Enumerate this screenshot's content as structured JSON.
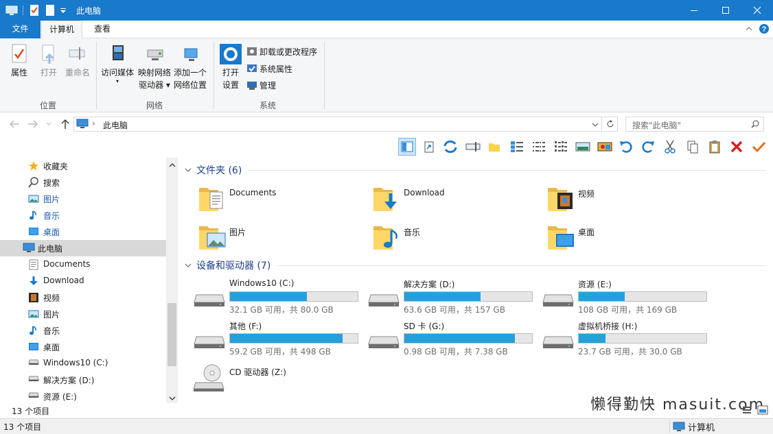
{
  "window": {
    "title": "此电脑"
  },
  "ribbon_tabs": [
    "文件",
    "计算机",
    "查看"
  ],
  "ribbon": {
    "location": {
      "properties": "属性",
      "open": "打开",
      "rename": "重命名",
      "group": "位置"
    },
    "network": {
      "access_media": "访问媒体",
      "map_drive_1": "映射网络",
      "map_drive_2": "驱动器",
      "add_location_1": "添加一个",
      "add_location_2": "网络位置",
      "group": "网络"
    },
    "system": {
      "open_settings_1": "打开",
      "open_settings_2": "设置",
      "uninstall": "卸载或更改程序",
      "sys_props": "系统属性",
      "manage": "管理",
      "group": "系统"
    }
  },
  "address": {
    "path": "此电脑",
    "search_placeholder": "搜索\"此电脑\""
  },
  "sidebar": [
    {
      "label": "收藏夹",
      "icon": "star-icon",
      "link": false
    },
    {
      "label": "搜索",
      "icon": "search-icon",
      "link": false
    },
    {
      "label": "图片",
      "icon": "pictures-icon",
      "link": true
    },
    {
      "label": "音乐",
      "icon": "music-icon",
      "link": true
    },
    {
      "label": "桌面",
      "icon": "desktop-icon",
      "link": true
    },
    {
      "label": "此电脑",
      "icon": "computer-icon",
      "link": false,
      "selected": true
    },
    {
      "label": "Documents",
      "icon": "documents-icon",
      "link": false
    },
    {
      "label": "Download",
      "icon": "download-icon",
      "link": false
    },
    {
      "label": "视频",
      "icon": "video-icon",
      "link": false
    },
    {
      "label": "图片",
      "icon": "pictures-icon",
      "link": false
    },
    {
      "label": "音乐",
      "icon": "music-icon",
      "link": false
    },
    {
      "label": "桌面",
      "icon": "desktop-icon",
      "link": false
    },
    {
      "label": "Windows10 (C:)",
      "icon": "drive-icon",
      "link": false
    },
    {
      "label": "解决方案 (D:)",
      "icon": "drive-icon",
      "link": false
    },
    {
      "label": "资源 (E:)",
      "icon": "drive-icon",
      "link": false
    }
  ],
  "folders_section": "文件夹 (6)",
  "folders": [
    {
      "label": "Documents",
      "icon": "documents-folder-icon"
    },
    {
      "label": "Download",
      "icon": "download-folder-icon"
    },
    {
      "label": "视频",
      "icon": "video-folder-icon"
    },
    {
      "label": "图片",
      "icon": "pictures-folder-icon"
    },
    {
      "label": "音乐",
      "icon": "music-folder-icon"
    },
    {
      "label": "桌面",
      "icon": "desktop-folder-icon"
    }
  ],
  "drives_section": "设备和驱动器 (7)",
  "drives": [
    {
      "label": "Windows10 (C:)",
      "free": "32.1 GB 可用，共 80.0 GB",
      "used_fraction": 0.6
    },
    {
      "label": "解决方案 (D:)",
      "free": "63.6 GB 可用，共 157 GB",
      "used_fraction": 0.595
    },
    {
      "label": "资源 (E:)",
      "free": "108 GB 可用，共 169 GB",
      "used_fraction": 0.36
    },
    {
      "label": "其他 (F:)",
      "free": "59.2 GB 可用，共 498 GB",
      "used_fraction": 0.881
    },
    {
      "label": "SD 卡 (G:)",
      "free": "0.98 GB 可用，共 7.38 GB",
      "used_fraction": 0.867
    },
    {
      "label": "虚拟机桥接 (H:)",
      "free": "23.7 GB 可用，共 30.0 GB",
      "used_fraction": 0.21
    }
  ],
  "cd_drive": "CD 驱动器 (Z:)",
  "item_count": "13 个项目",
  "status_left": "13 个项目",
  "status_zone": "计算机",
  "watermark": "懒得勤快 masuit.com",
  "colors": {
    "accent": "#1979ca",
    "drive_bar": "#26a0da"
  }
}
